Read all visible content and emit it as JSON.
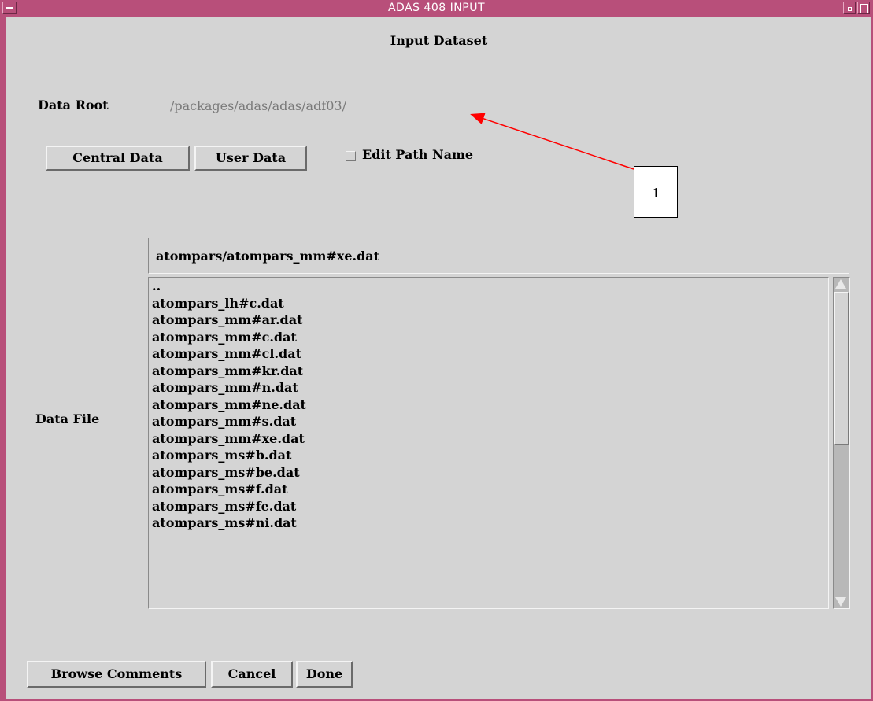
{
  "window": {
    "title": "ADAS 408 INPUT"
  },
  "dialog": {
    "section_title": "Input Dataset",
    "data_root_label": "Data Root",
    "data_root_value": "/packages/adas/adas/adf03/",
    "central_data_button": "Central Data",
    "user_data_button": "User Data",
    "edit_path_label": "Edit Path Name",
    "edit_path_checked": false,
    "data_file_label": "Data File",
    "data_file_value": "atompars/atompars_mm#xe.dat",
    "file_list": [
      "..",
      "atompars_lh#c.dat",
      "atompars_mm#ar.dat",
      "atompars_mm#c.dat",
      "atompars_mm#cl.dat",
      "atompars_mm#kr.dat",
      "atompars_mm#n.dat",
      "atompars_mm#ne.dat",
      "atompars_mm#s.dat",
      "atompars_mm#xe.dat",
      "atompars_ms#b.dat",
      "atompars_ms#be.dat",
      "atompars_ms#f.dat",
      "atompars_ms#fe.dat",
      "atompars_ms#ni.dat"
    ],
    "browse_comments_button": "Browse Comments",
    "cancel_button": "Cancel",
    "done_button": "Done"
  },
  "annotation": {
    "callout_number": "1",
    "arrow_color": "#ff0000"
  },
  "colors": {
    "titlebar": "#b84f7a",
    "panel": "#d4d4d4"
  }
}
